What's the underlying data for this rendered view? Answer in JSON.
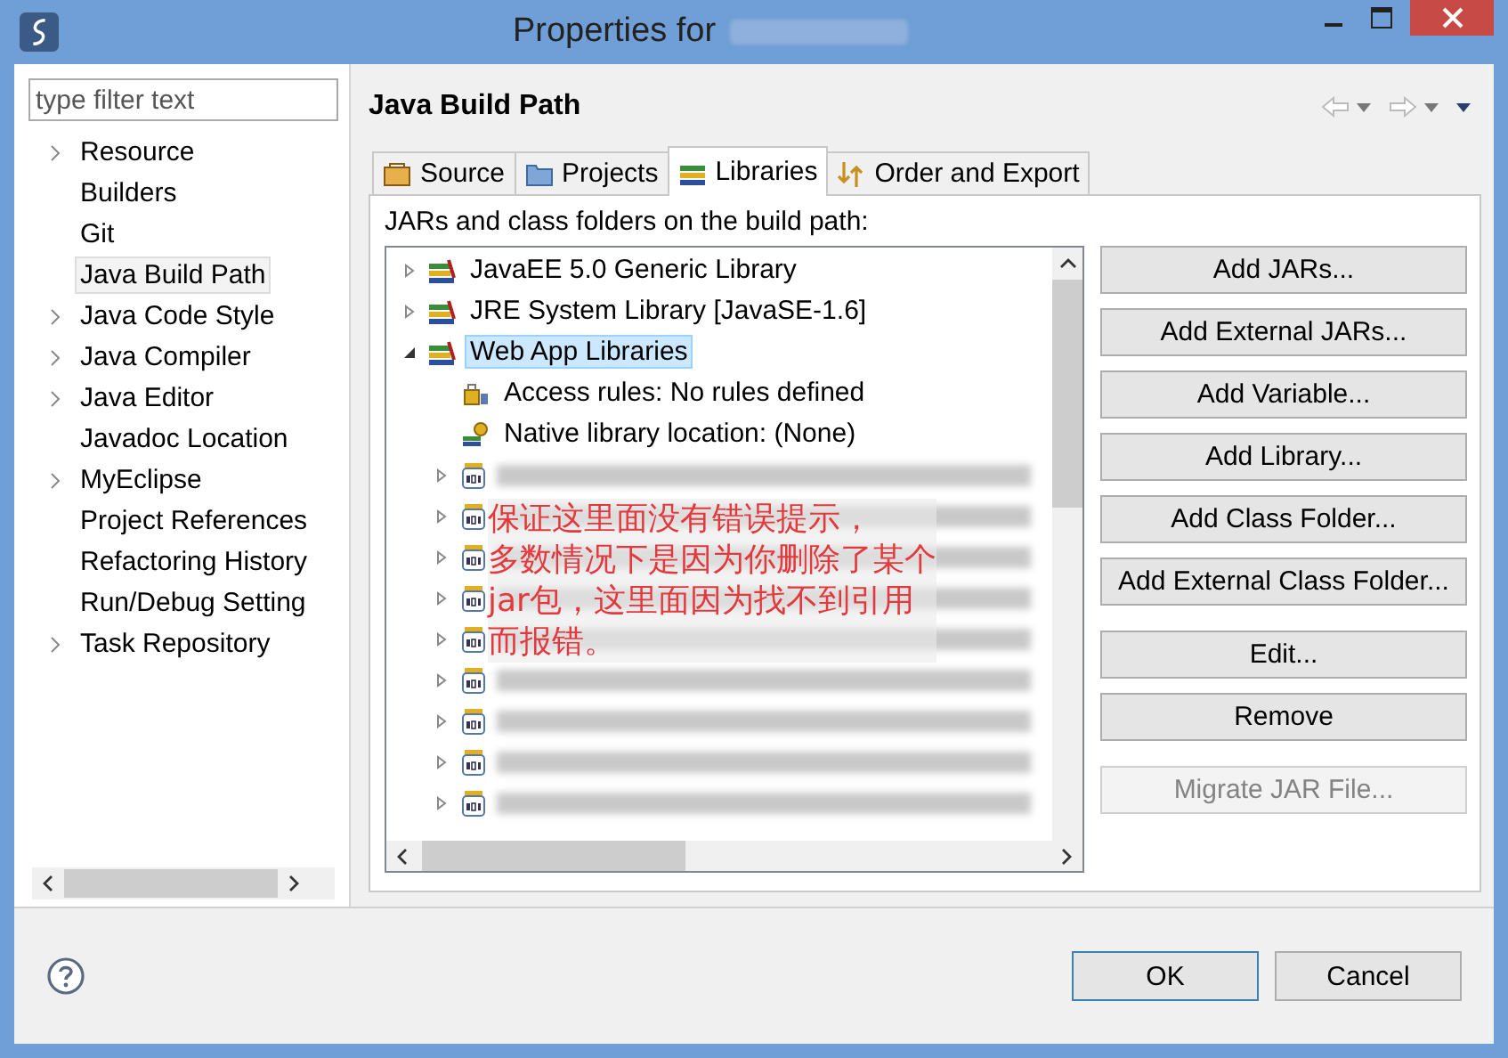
{
  "window": {
    "title": "Properties for"
  },
  "filter": {
    "placeholder": "type filter text"
  },
  "sidebar": {
    "items": [
      {
        "label": "Resource",
        "kind": "branch",
        "selected": false
      },
      {
        "label": "Builders",
        "kind": "leaf",
        "selected": false
      },
      {
        "label": "Git",
        "kind": "leaf",
        "selected": false
      },
      {
        "label": "Java Build Path",
        "kind": "leaf",
        "selected": true
      },
      {
        "label": "Java Code Style",
        "kind": "branch",
        "selected": false
      },
      {
        "label": "Java Compiler",
        "kind": "branch",
        "selected": false
      },
      {
        "label": "Java Editor",
        "kind": "branch",
        "selected": false
      },
      {
        "label": "Javadoc Location",
        "kind": "leaf",
        "selected": false
      },
      {
        "label": "MyEclipse",
        "kind": "branch",
        "selected": false
      },
      {
        "label": "Project References",
        "kind": "leaf",
        "selected": false
      },
      {
        "label": "Refactoring History",
        "kind": "leaf",
        "selected": false
      },
      {
        "label": "Run/Debug Setting",
        "kind": "leaf",
        "selected": false
      },
      {
        "label": "Task Repository",
        "kind": "branch",
        "selected": false
      }
    ]
  },
  "page": {
    "title": "Java Build Path"
  },
  "tabs": [
    {
      "label": "Source",
      "kind": "source",
      "selected": false
    },
    {
      "label": "Projects",
      "kind": "projects",
      "selected": false
    },
    {
      "label": "Libraries",
      "kind": "libraries",
      "selected": true
    },
    {
      "label": "Order and Export",
      "kind": "order",
      "selected": false
    }
  ],
  "libraries": {
    "caption": "JARs and class folders on the build path:",
    "items": [
      {
        "label": "JavaEE 5.0 Generic Library",
        "expanded": false,
        "selected": false
      },
      {
        "label": "JRE System Library [JavaSE-1.6]",
        "expanded": false,
        "selected": false
      },
      {
        "label": "Web App Libraries",
        "expanded": true,
        "selected": true,
        "children": [
          {
            "label": "Access rules: No rules defined",
            "kind": "rules"
          },
          {
            "label": "Native library location: (None)",
            "kind": "native"
          },
          {
            "kind": "jar",
            "expanded": false
          },
          {
            "kind": "jar",
            "expanded": false
          },
          {
            "kind": "jar",
            "expanded": false
          },
          {
            "kind": "jar",
            "expanded": false
          },
          {
            "kind": "jar",
            "expanded": false
          },
          {
            "kind": "jar",
            "expanded": false
          },
          {
            "kind": "jar",
            "expanded": false
          },
          {
            "kind": "jar",
            "expanded": false
          },
          {
            "kind": "jar",
            "expanded": false
          }
        ]
      }
    ]
  },
  "annotation": {
    "lines": [
      "保证这里面没有错误提示，",
      "多数情况下是因为你删除了某个",
      "jar包，这里面因为找不到引用",
      "而报错。"
    ]
  },
  "button_groups": [
    [
      {
        "label": "Add JARs...",
        "disabled": false
      },
      {
        "label": "Add External JARs...",
        "disabled": false
      },
      {
        "label": "Add Variable...",
        "disabled": false
      },
      {
        "label": "Add Library...",
        "disabled": false
      },
      {
        "label": "Add Class Folder...",
        "disabled": false
      },
      {
        "label": "Add External Class Folder...",
        "disabled": false
      }
    ],
    [
      {
        "label": "Edit...",
        "disabled": false
      },
      {
        "label": "Remove",
        "disabled": false
      }
    ],
    [
      {
        "label": "Migrate JAR File...",
        "disabled": true
      }
    ]
  ],
  "dialog_buttons": [
    {
      "label": "OK",
      "default": true
    },
    {
      "label": "Cancel",
      "default": false
    }
  ]
}
